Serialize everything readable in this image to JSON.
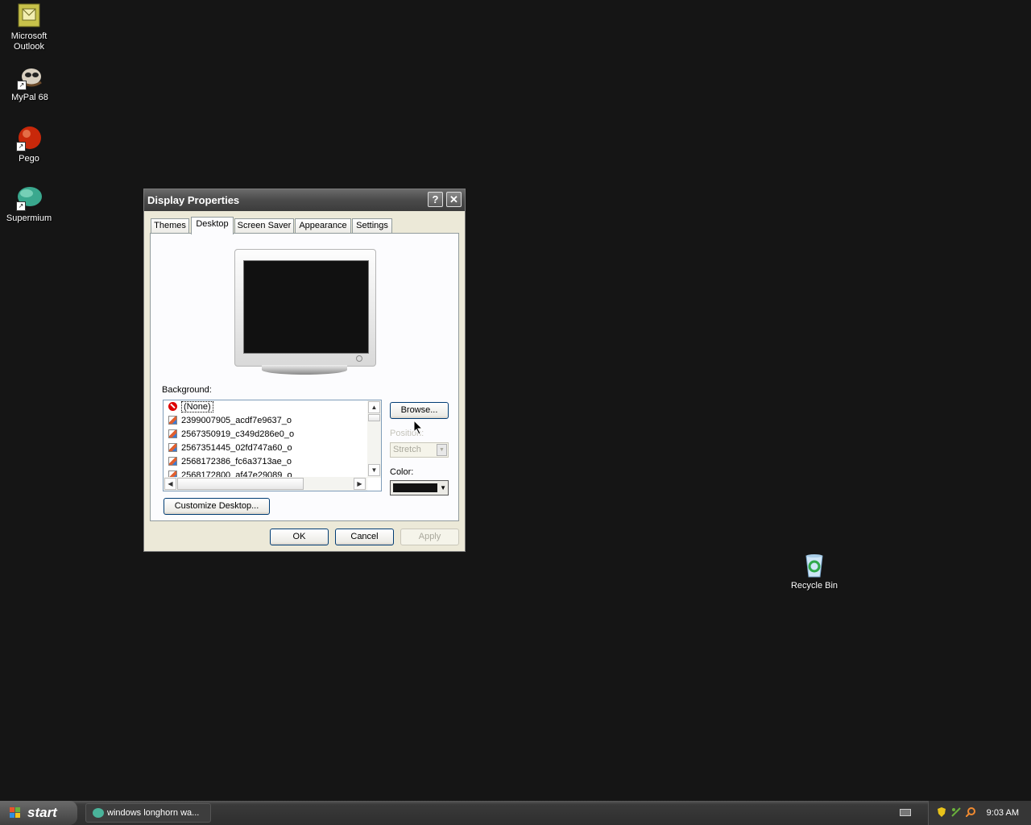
{
  "desktop": {
    "icons": [
      {
        "label_line1": "Microsoft",
        "label_line2": "Outlook"
      },
      {
        "label_line1": "MyPal 68",
        "label_line2": ""
      },
      {
        "label_line1": "Pego",
        "label_line2": ""
      },
      {
        "label_line1": "Supermium",
        "label_line2": ""
      },
      {
        "label_line1": "Recycle Bin",
        "label_line2": ""
      }
    ]
  },
  "dialog": {
    "title": "Display Properties",
    "help_glyph": "?",
    "close_glyph": "✕",
    "tabs": [
      "Themes",
      "Desktop",
      "Screen Saver",
      "Appearance",
      "Settings"
    ],
    "active_tab": "Desktop",
    "background_label": "Background:",
    "background_items": [
      "(None)",
      "2399007905_acdf7e9637_o",
      "2567350919_c349d286e0_o",
      "2567351445_02fd747a60_o",
      "2568172386_fc6a3713ae_o",
      "2568172800_af47e29089_o"
    ],
    "browse_label": "Browse...",
    "position_label": "Position:",
    "position_value": "Stretch",
    "color_label": "Color:",
    "color_value": "#121212",
    "customize_label": "Customize Desktop...",
    "ok_label": "OK",
    "cancel_label": "Cancel",
    "apply_label": "Apply"
  },
  "taskbar": {
    "start_label": "start",
    "task_label": "windows longhorn wa...",
    "clock": "9:03 AM"
  }
}
